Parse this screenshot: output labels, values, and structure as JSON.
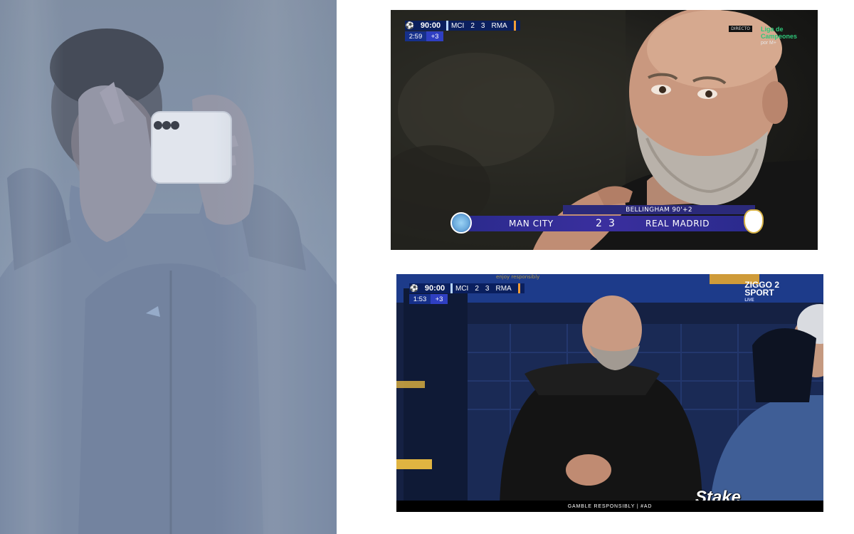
{
  "top_broadcast": {
    "scoreboard": {
      "match_time": "90:00",
      "home_abbr": "MCI",
      "home_score": "2",
      "away_score": "3",
      "away_abbr": "RMA",
      "clock": "2:59",
      "added_time": "+3"
    },
    "goal_strip": {
      "scorer": "BELLINGHAM 90'+2",
      "home_team": "MAN CITY",
      "home_score": "2",
      "away_score": "3",
      "away_team": "REAL MADRID"
    },
    "channel": {
      "live_tag": "DIRECTO",
      "name": "Liga de Campeones",
      "by": "por M+"
    }
  },
  "bottom_broadcast": {
    "scoreboard": {
      "match_time": "90:00",
      "home_abbr": "MCI",
      "home_score": "2",
      "away_score": "3",
      "away_abbr": "RMA",
      "clock": "1:53",
      "added_time": "+3"
    },
    "channel": {
      "name_line1": "ZIGGO 2",
      "name_line2": "SPORT",
      "live": "LIVE"
    },
    "ad_banner": "enjoy responsibly",
    "sponsor": "Stake",
    "footer": "GAMBLE RESPONSIBLY | #AD"
  },
  "colors": {
    "bug_navy": "#0a1f5e",
    "strip_purple": "#2b2a7a",
    "watermark_green": "#2ec77a",
    "city_blue": "#6cabdd"
  }
}
